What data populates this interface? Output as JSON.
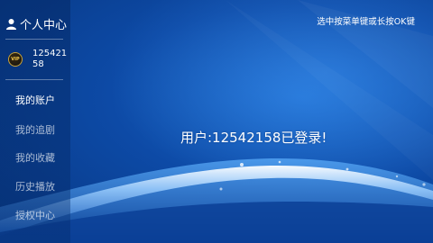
{
  "header": {
    "title": "个人中心"
  },
  "user": {
    "vip_badge": "VIP",
    "id_text": "12542158"
  },
  "menu": {
    "items": [
      {
        "label": "我的账户"
      },
      {
        "label": "我的追剧"
      },
      {
        "label": "我的收藏"
      },
      {
        "label": "历史播放"
      },
      {
        "label": "授权中心"
      }
    ]
  },
  "hint": "选中按菜单键或长按OK键",
  "status_message": "用户:12542158已登录!",
  "colors": {
    "background": "#0d4aa6",
    "text": "#ffffff"
  },
  "icons": {
    "header": "person-icon"
  }
}
